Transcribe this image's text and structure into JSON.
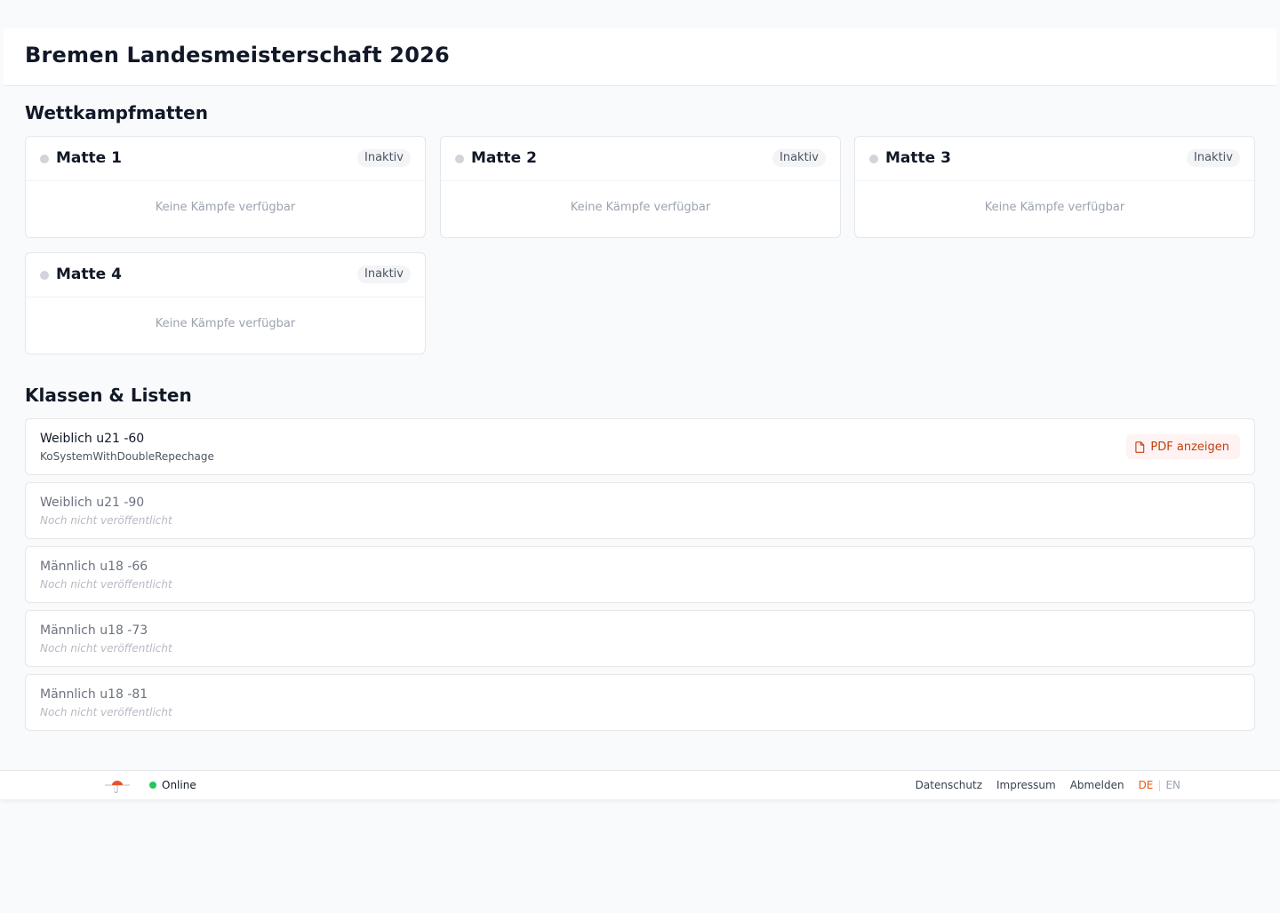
{
  "header": {
    "title": "Bremen Landesmeisterschaft 2026"
  },
  "mats_section": {
    "title": "Wettkampfmatten",
    "mats": [
      {
        "name": "Matte 1",
        "status": "Inaktiv",
        "empty_text": "Keine Kämpfe verfügbar"
      },
      {
        "name": "Matte 2",
        "status": "Inaktiv",
        "empty_text": "Keine Kämpfe verfügbar"
      },
      {
        "name": "Matte 3",
        "status": "Inaktiv",
        "empty_text": "Keine Kämpfe verfügbar"
      },
      {
        "name": "Matte 4",
        "status": "Inaktiv",
        "empty_text": "Keine Kämpfe verfügbar"
      }
    ]
  },
  "classes_section": {
    "title": "Klassen & Listen",
    "classes": [
      {
        "name": "Weiblich u21 -60",
        "sub": "KoSystemWithDoubleRepechage",
        "published": true,
        "pdf_label": "PDF anzeigen",
        "pdf_icon": "document-icon"
      },
      {
        "name": "Weiblich u21 -90",
        "sub": "Noch nicht veröffentlicht",
        "published": false
      },
      {
        "name": "Männlich u18 -66",
        "sub": "Noch nicht veröffentlicht",
        "published": false
      },
      {
        "name": "Männlich u18 -73",
        "sub": "Noch nicht veröffentlicht",
        "published": false
      },
      {
        "name": "Männlich u18 -81",
        "sub": "Noch nicht veröffentlicht",
        "published": false
      }
    ]
  },
  "footer": {
    "logo_icon": "referee-umbrella-icon",
    "status": "Online",
    "status_color": "#22c55e",
    "links": {
      "privacy": "Datenschutz",
      "imprint": "Impressum",
      "logout": "Abmelden"
    },
    "lang": {
      "active": "DE",
      "inactive": "EN",
      "active_color": "#ea580c"
    }
  }
}
